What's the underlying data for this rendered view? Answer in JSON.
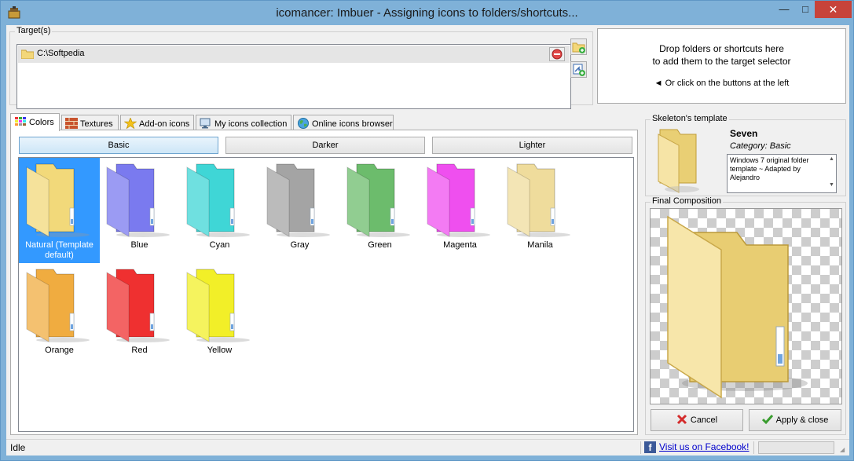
{
  "window": {
    "title": "icomancer: Imbuer - Assigning icons to folders/shortcuts...",
    "min_glyph": "—",
    "max_glyph": "□",
    "close_glyph": "✕"
  },
  "targets": {
    "label": "Target(s)",
    "items": [
      {
        "path": "C:\\Softpedia"
      }
    ]
  },
  "drop_area": {
    "line1": "Drop folders or shortcuts here",
    "line2": "to add them to the target selector",
    "line3": "◄ Or click on the buttons at the left"
  },
  "tabs": [
    {
      "label": "Colors",
      "icon": "colors-grid-icon",
      "active": true
    },
    {
      "label": "Textures",
      "icon": "brick-texture-icon"
    },
    {
      "label": "Add-on icons",
      "icon": "star-icon"
    },
    {
      "label": "My icons collection",
      "icon": "computer-icon"
    },
    {
      "label": "Online icons browser",
      "icon": "globe-icon"
    }
  ],
  "color_filters": [
    {
      "label": "Basic",
      "active": true
    },
    {
      "label": "Darker"
    },
    {
      "label": "Lighter"
    }
  ],
  "swatches": [
    {
      "label": "Natural (Template default)",
      "color": "#f2d97a",
      "selected": true
    },
    {
      "label": "Blue",
      "color": "#7a7aef"
    },
    {
      "label": "Cyan",
      "color": "#3fd6d6"
    },
    {
      "label": "Gray",
      "color": "#a4a4a4"
    },
    {
      "label": "Green",
      "color": "#6cbc6c"
    },
    {
      "label": "Magenta",
      "color": "#ef4fef"
    },
    {
      "label": "Manila",
      "color": "#efdc9c"
    },
    {
      "label": "Orange",
      "color": "#f0ac40"
    },
    {
      "label": "Red",
      "color": "#ef3030"
    },
    {
      "label": "Yellow",
      "color": "#f2ef28"
    }
  ],
  "skeleton": {
    "label": "Skeleton's template",
    "name": "Seven",
    "category": "Category: Basic",
    "description": "Windows 7 original folder template ~ Adapted by Alejandro",
    "scroll_up": "▲",
    "scroll_down": "▼"
  },
  "final": {
    "label": "Final Composition",
    "cancel_label": "Cancel",
    "apply_label": "Apply & close"
  },
  "status": {
    "text": "Idle",
    "facebook_label": "Visit us on Facebook!",
    "facebook_glyph": "f"
  },
  "colors": {
    "accent_selection": "#3399ff",
    "titlebar": "#7fb1d8",
    "close_button": "#c7433a"
  }
}
